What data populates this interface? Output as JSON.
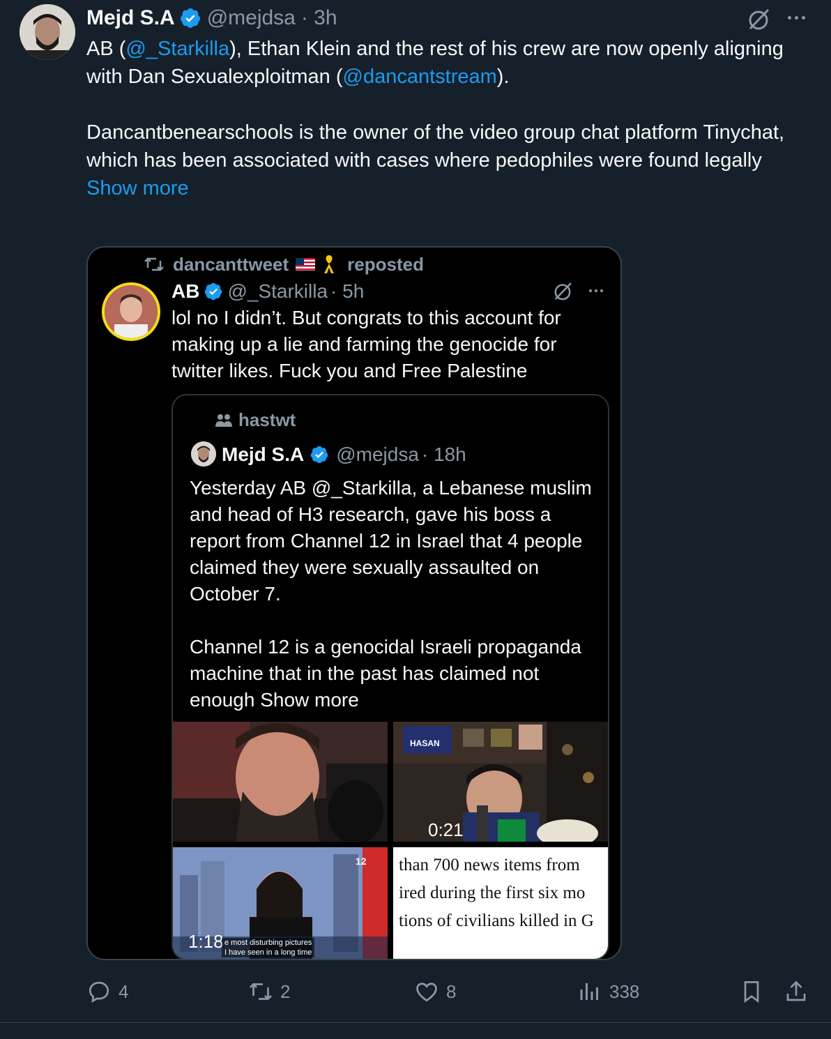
{
  "tweet": {
    "author_name": "Mejd S.A",
    "handle": "@mejdsa",
    "time": "· 3h",
    "text_prefix": "AB (",
    "mention_1": "@_Starkilla",
    "text_middle": "), Ethan Klein and the rest of his crew are now openly aligning with Dan Sexualexploitman (",
    "mention_2": "@dancantstream",
    "text_suffix": ").",
    "paragraph_2": "Dancantbenearschools is the owner of the video group chat platform Tinychat, which has been associated with cases where pedophiles were found legally",
    "show_more": "Show more"
  },
  "embed": {
    "reposter": "dancanttweet",
    "repost_label": "reposted",
    "ab_name": "AB",
    "ab_handle": "@_Starkilla",
    "ab_time": "· 5h",
    "ab_text": "lol no I didn’t. But congrats to this account for making up a lie and farming the genocide for twitter likes. Fuck you and Free Palestine",
    "community": "hastwt",
    "quoted_name": "Mejd S.A",
    "quoted_handle": "@mejdsa",
    "quoted_time": "· 18h",
    "quoted_p1": "Yesterday AB @_Starkilla, a Lebanese muslim and head of H3 research, gave his boss a report from Channel 12 in Israel that 4 people claimed they were sexually assaulted on October 7.",
    "quoted_p2": "Channel 12 is a genocidal Israeli propaganda machine that in the past has claimed not enough Show more",
    "video_duration_1": "0:21",
    "video_duration_2": "1:18",
    "tile2_sign": "HASAN",
    "tile3_channel": "12",
    "tile3_subtitle_1": "e most disturbing pictures",
    "tile3_subtitle_2": "I have seen in a long time",
    "tile4_line1": "than 700 news items from",
    "tile4_line2": "ired during the first six mo",
    "tile4_line3": "tions of civilians killed in G"
  },
  "actions": {
    "replies": "4",
    "reposts": "2",
    "likes": "8",
    "views": "338"
  },
  "colors": {
    "background": "#15202b",
    "accent": "#1d9bf0",
    "muted": "#8b98a5",
    "gold_ring": "#f5dd16"
  },
  "icons": [
    "verified-badge-icon",
    "grok-icon",
    "more-icon",
    "repost-icon",
    "flag-icon",
    "ribbon-icon",
    "community-icon",
    "reply-icon",
    "like-icon",
    "views-icon",
    "bookmark-icon",
    "share-icon"
  ]
}
